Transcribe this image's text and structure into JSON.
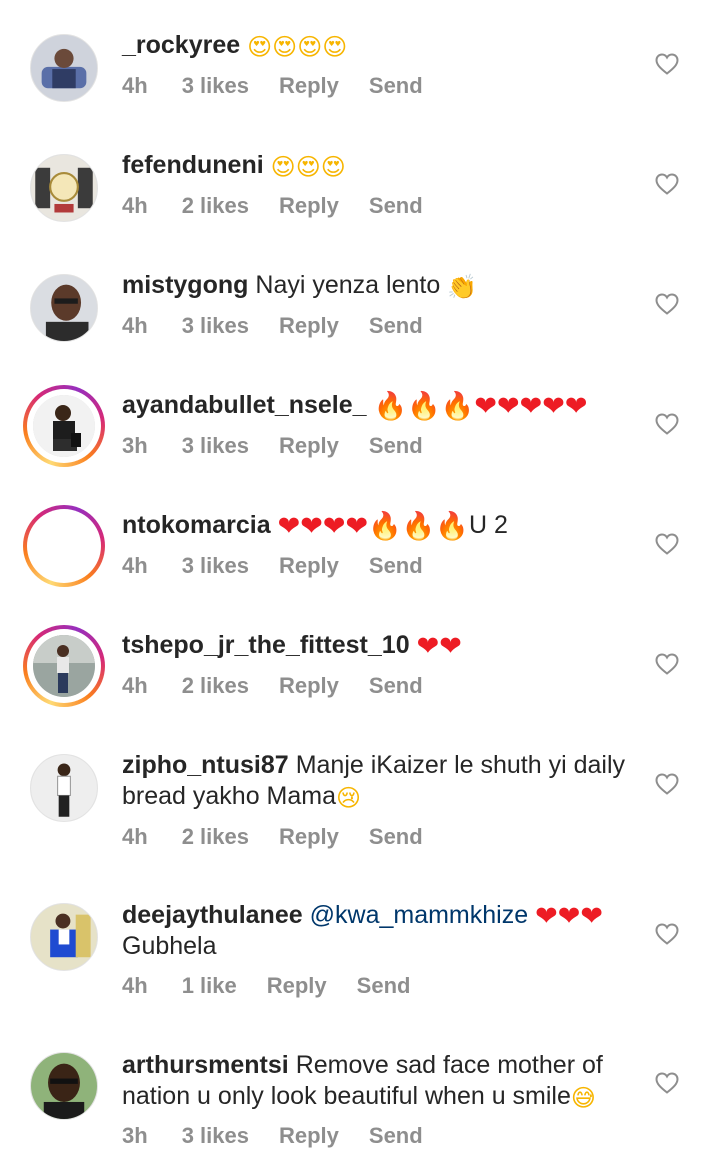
{
  "comments": [
    {
      "username": "_rockyree",
      "text": "",
      "emoji_after": "😍😍😍😍",
      "time": "4h",
      "likes": "3 likes",
      "reply": "Reply",
      "send": "Send",
      "avatar": "plain"
    },
    {
      "username": "fefenduneni",
      "text": "",
      "emoji_after": "😍😍😍",
      "time": "4h",
      "likes": "2 likes",
      "reply": "Reply",
      "send": "Send",
      "avatar": "plain"
    },
    {
      "username": "mistygong",
      "text": "Nayi yenza lento",
      "emoji_after": "👏",
      "time": "4h",
      "likes": "3 likes",
      "reply": "Reply",
      "send": "Send",
      "avatar": "plain"
    },
    {
      "username": "ayandabullet_nsele_",
      "text": "",
      "emoji_after": "🔥🔥🔥❤❤❤❤❤",
      "time": "3h",
      "likes": "3 likes",
      "reply": "Reply",
      "send": "Send",
      "avatar": "ring"
    },
    {
      "username": "ntokomarcia",
      "text": "",
      "emoji_after": "❤❤❤❤🔥🔥🔥",
      "text_after": "U 2",
      "time": "4h",
      "likes": "3 likes",
      "reply": "Reply",
      "send": "Send",
      "avatar": "ring"
    },
    {
      "username": "tshepo_jr_the_fittest_10",
      "text": "",
      "emoji_after": "❤❤",
      "time": "4h",
      "likes": "2 likes",
      "reply": "Reply",
      "send": "Send",
      "avatar": "ring"
    },
    {
      "username": "zipho_ntusi87",
      "text": "Manje iKaizer le shuth yi daily bread yakho Mama",
      "emoji_after": "😢",
      "time": "4h",
      "likes": "2 likes",
      "reply": "Reply",
      "send": "Send",
      "avatar": "plain"
    },
    {
      "username": "deejaythulanee",
      "mention": "@kwa_mammkhize",
      "emoji_mid": "❤❤❤",
      "text": "Gubhela",
      "time": "4h",
      "likes": "1 like",
      "reply": "Reply",
      "send": "Send",
      "avatar": "plain"
    },
    {
      "username": "arthursmentsi",
      "text": "Remove sad face mother of nation u only look beautiful when u smile",
      "emoji_after": "😅",
      "time": "3h",
      "likes": "3 likes",
      "reply": "Reply",
      "send": "Send",
      "avatar": "plain"
    }
  ],
  "icons": {
    "like": "heart-outline-icon",
    "avatar": "user-avatar"
  },
  "colors": {
    "username": "#262626",
    "meta": "#8e8e8e",
    "mention": "#00376b",
    "heart_emoji": "#ed1c24",
    "story_ring_start": "#feda75",
    "story_ring_mid": "#d62976",
    "story_ring_end": "#962fbf"
  }
}
